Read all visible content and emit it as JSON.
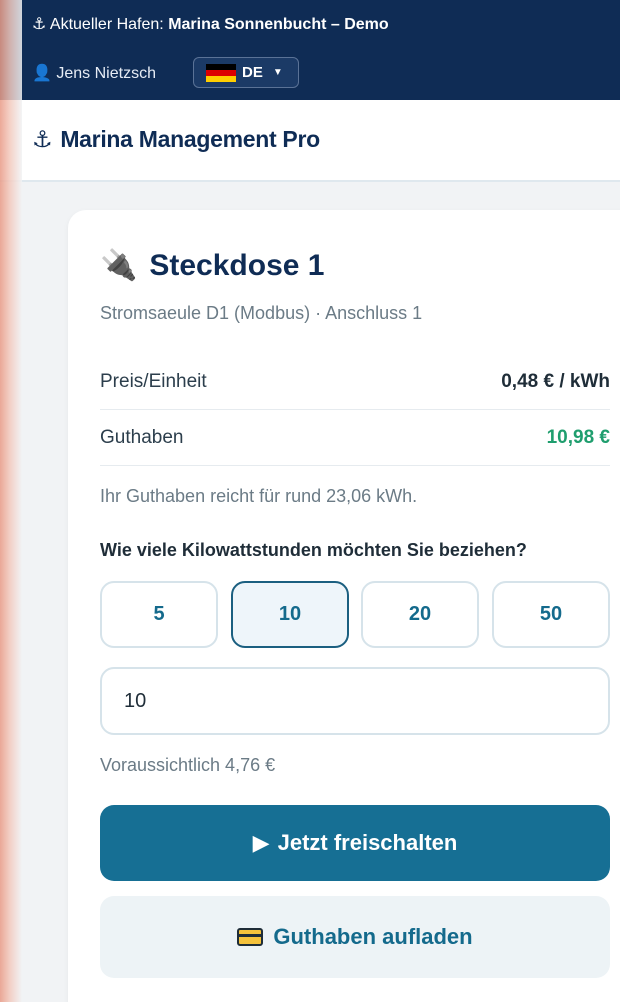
{
  "topbar": {
    "harbor_prefix": "Aktueller Hafen:",
    "harbor_name": "Marina Sonnenbucht – Demo",
    "user_name": "Jens Nietzsch",
    "language": "DE"
  },
  "header": {
    "brand": "Marina Management Pro"
  },
  "socket": {
    "title": "Steckdose 1",
    "subtitle": "Stromsaeule D1 (Modbus) · Anschluss 1",
    "price_label": "Preis/Einheit",
    "price_value": "0,48 € / kWh",
    "balance_label": "Guthaben",
    "balance_value": "10,98 €",
    "hint": "Ihr Guthaben reicht für rund 23,06 kWh.",
    "question": "Wie viele Kilowattstunden möchten Sie beziehen?",
    "presets": [
      "5",
      "10",
      "20",
      "50"
    ],
    "selected_preset": "10",
    "quantity_value": "10",
    "estimate": "Voraussichtlich 4,76 €",
    "unlock_button": "Jetzt freischalten",
    "topup_button": "Guthaben aufladen"
  },
  "colors": {
    "topbar_bg": "#0f2c55",
    "primary": "#166f94",
    "balance_green": "#1f9e6e"
  }
}
